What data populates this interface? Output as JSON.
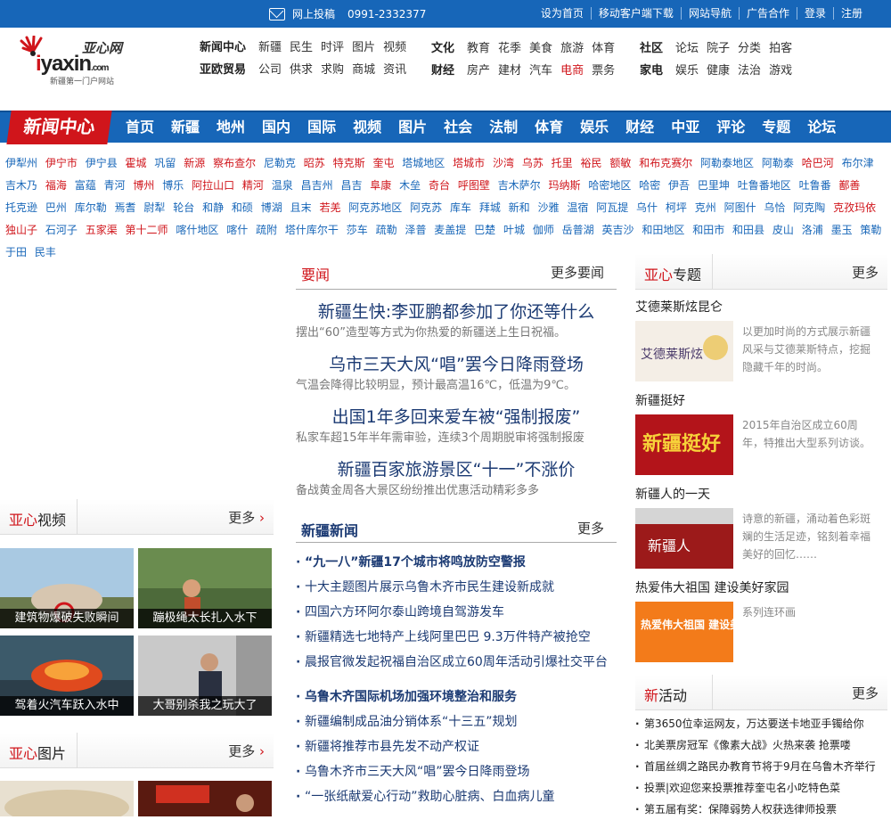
{
  "topbar": {
    "submit_label": "网上投稿",
    "phone": "0991-2332377",
    "links": [
      "设为首页",
      "移动客户端下载",
      "网站导航",
      "广告合作",
      "登录",
      "注册"
    ]
  },
  "logo": {
    "brand": "亚心网",
    "domain_pre": "i",
    "domain": "yaxin",
    "domain_suf": ".com",
    "slogan": "新疆第一门户网站"
  },
  "nav_groups": [
    {
      "rows": [
        {
          "head": "新闻中心",
          "items": [
            "新疆",
            "民生",
            "时评",
            "图片",
            "视频"
          ]
        },
        {
          "head": "亚欧贸易",
          "items": [
            "公司",
            "供求",
            "求购",
            "商城",
            "资讯"
          ]
        }
      ]
    },
    {
      "rows": [
        {
          "head": "文化",
          "items": [
            "教育",
            "花季",
            "美食",
            "旅游",
            "体育"
          ]
        },
        {
          "head": "财经",
          "items": [
            "房产",
            "建材",
            "汽车",
            "电商",
            "票务"
          ]
        }
      ]
    },
    {
      "rows": [
        {
          "head": "社区",
          "items": [
            "论坛",
            "院子",
            "分类",
            "拍客"
          ]
        },
        {
          "head": "家电",
          "items": [
            "娱乐",
            "健康",
            "法治",
            "游戏"
          ]
        }
      ]
    }
  ],
  "mainnav": {
    "title": "新闻中心",
    "items": [
      "首页",
      "新疆",
      "地州",
      "国内",
      "国际",
      "视频",
      "图片",
      "社会",
      "法制",
      "体育",
      "娱乐",
      "财经",
      "中亚",
      "评论",
      "专题",
      "论坛"
    ]
  },
  "regions": [
    {
      "t": "伊犁州"
    },
    {
      "t": "伊宁市",
      "red": true
    },
    {
      "t": "伊宁县"
    },
    {
      "t": "霍城",
      "red": true
    },
    {
      "t": "巩留"
    },
    {
      "t": "新源",
      "red": true
    },
    {
      "t": "察布查尔",
      "red": true
    },
    {
      "t": "尼勒克"
    },
    {
      "t": "昭苏",
      "red": true
    },
    {
      "t": "特克斯",
      "red": true
    },
    {
      "t": "奎屯",
      "red": true
    },
    {
      "t": "塔城地区"
    },
    {
      "t": "塔城市",
      "red": true
    },
    {
      "t": "沙湾",
      "red": true
    },
    {
      "t": "乌苏",
      "red": true
    },
    {
      "t": "托里",
      "red": true
    },
    {
      "t": "裕民",
      "red": true
    },
    {
      "t": "额敏",
      "red": true
    },
    {
      "t": "和布克赛尔",
      "red": true
    },
    {
      "t": "阿勒泰地区"
    },
    {
      "t": "阿勒泰"
    },
    {
      "t": "哈巴河",
      "red": true
    },
    {
      "t": "布尔津"
    },
    {
      "t": "吉木乃"
    },
    {
      "t": "福海",
      "red": true
    },
    {
      "t": "富蕴"
    },
    {
      "t": "青河"
    },
    {
      "t": "博州",
      "red": true
    },
    {
      "t": "博乐"
    },
    {
      "t": "阿拉山口",
      "red": true
    },
    {
      "t": "精河",
      "red": true
    },
    {
      "t": "温泉"
    },
    {
      "t": "昌吉州"
    },
    {
      "t": "昌吉"
    },
    {
      "t": "阜康",
      "red": true
    },
    {
      "t": "木垒"
    },
    {
      "t": "奇台",
      "red": true
    },
    {
      "t": "呼图壁",
      "red": true
    },
    {
      "t": "吉木萨尔"
    },
    {
      "t": "玛纳斯",
      "red": true
    },
    {
      "t": "哈密地区"
    },
    {
      "t": "哈密"
    },
    {
      "t": "伊吾"
    },
    {
      "t": "巴里坤"
    },
    {
      "t": "吐鲁番地区"
    },
    {
      "t": "吐鲁番"
    },
    {
      "t": "鄯善",
      "red": true
    },
    {
      "t": "托克逊"
    },
    {
      "t": "巴州"
    },
    {
      "t": "库尔勒"
    },
    {
      "t": "焉耆"
    },
    {
      "t": "尉犁"
    },
    {
      "t": "轮台"
    },
    {
      "t": "和静"
    },
    {
      "t": "和硕"
    },
    {
      "t": "博湖"
    },
    {
      "t": "且末"
    },
    {
      "t": "若羌",
      "red": true
    },
    {
      "t": "阿克苏地区"
    },
    {
      "t": "阿克苏"
    },
    {
      "t": "库车"
    },
    {
      "t": "拜城"
    },
    {
      "t": "新和"
    },
    {
      "t": "沙雅"
    },
    {
      "t": "温宿"
    },
    {
      "t": "阿瓦提"
    },
    {
      "t": "乌什"
    },
    {
      "t": "柯坪"
    },
    {
      "t": "克州"
    },
    {
      "t": "阿图什"
    },
    {
      "t": "乌恰"
    },
    {
      "t": "阿克陶"
    },
    {
      "t": "克孜玛依",
      "red": true
    },
    {
      "t": "独山子",
      "red": true
    },
    {
      "t": "石河子"
    },
    {
      "t": "五家渠",
      "red": true
    },
    {
      "t": "第十二师",
      "red": true
    },
    {
      "t": "喀什地区"
    },
    {
      "t": "喀什"
    },
    {
      "t": "疏附"
    },
    {
      "t": "塔什库尔干"
    },
    {
      "t": "莎车"
    },
    {
      "t": "疏勒"
    },
    {
      "t": "泽普"
    },
    {
      "t": "麦盖提"
    },
    {
      "t": "巴楚"
    },
    {
      "t": "叶城"
    },
    {
      "t": "伽师"
    },
    {
      "t": "岳普湖"
    },
    {
      "t": "英吉沙"
    },
    {
      "t": "和田地区"
    },
    {
      "t": "和田市"
    },
    {
      "t": "和田县"
    },
    {
      "t": "皮山"
    },
    {
      "t": "洛浦"
    },
    {
      "t": "墨玉"
    },
    {
      "t": "策勒"
    },
    {
      "t": "于田"
    },
    {
      "t": "民丰"
    }
  ],
  "yaowen": {
    "title": "要闻",
    "more": "更多要闻",
    "stories": [
      {
        "h": "新疆生快:李亚鹏都参加了你还等什么",
        "d": "摆出“60”造型等方式为你热爱的新疆送上生日祝福。"
      },
      {
        "h": "乌市三天大风“唱”罢今日降雨登场",
        "d": "气温会降得比较明显，预计最高温16℃，低温为9℃。"
      },
      {
        "h": "出国1年多回来爱车被“强制报废”",
        "d": "私家车超15年半年需审验，连续3个周期脱审将强制报废"
      },
      {
        "h": "新疆百家旅游景区“十一”不涨价",
        "d": "备战黄金周各大景区纷纷推出优惠活动精彩多多"
      }
    ]
  },
  "xjnews": {
    "title": "新疆新闻",
    "more": "更多",
    "items": [
      {
        "t": "“九一八”新疆17个城市将鸣放防空警报",
        "bold": true
      },
      {
        "t": "十大主题图片展示乌鲁木齐市民生建设新成就"
      },
      {
        "t": "四国六方环阿尔泰山跨境自驾游发车"
      },
      {
        "t": "新疆精选七地特产上线阿里巴巴 9.3万件特产被抢空"
      },
      {
        "t": "晨报官微发起祝福自治区成立60周年活动引爆社交平台"
      },
      {
        "t": "乌鲁木齐国际机场加强环境整治和服务",
        "bold": true
      },
      {
        "t": "新疆编制成品油分销体系“十三五”规划"
      },
      {
        "t": "新疆将推荐市县先发不动产权证"
      },
      {
        "t": "乌鲁木齐市三天大风“唱”罢今日降雨登场"
      },
      {
        "t": "“一张纸献爱心行动”救助心脏病、白血病儿童"
      }
    ]
  },
  "video": {
    "title_red": "亚心",
    "title": "视频",
    "more": "更多",
    "items": [
      "建筑物爆破失败瞬间",
      "蹦极绳太长扎入水下",
      "驾着火汽车跃入水中",
      "大哥别杀我之玩大了"
    ]
  },
  "pics": {
    "title_red": "亚心",
    "title": "图片",
    "more": "更多"
  },
  "topics": {
    "title_red": "亚心",
    "title": "专题",
    "more": "更多",
    "items": [
      {
        "t": "艾德莱斯炫昆仑",
        "d": "以更加时尚的方式展示新疆风采与艾德莱斯特点，挖掘隐藏千年的时尚。",
        "img": "艾德莱斯炫"
      },
      {
        "t": "新疆挺好",
        "d": "2015年自治区成立60周年，特推出大型系列访谈。",
        "img": "新疆挺好"
      },
      {
        "t": "新疆人的一天",
        "d": "诗意的新疆，涌动着色彩斑斓的生活足迹，铭刻着幸福美好的回忆……",
        "img": "新疆人"
      },
      {
        "t": "热爱伟大祖国 建设美好家园",
        "d": "系列连环画",
        "img": "热爱伟大祖国 建设美好家园"
      }
    ]
  },
  "activity": {
    "title_red": "新",
    "title": "活动",
    "more": "更多",
    "items": [
      "第3650位幸运网友，万达要送卡地亚手镯给你",
      "北美票房冠军《像素大战》火热来袭 抢票喽",
      "首届丝绸之路民办教育节将于9月在乌鲁木齐举行",
      "投票|欢迎您来投票推荐奎屯名小吃特色菜",
      "第五届有奖：保障弱势人权获选律师投票"
    ]
  },
  "colors": {
    "brand_blue": "#1766b8",
    "brand_red": "#d0151b",
    "headline_navy": "#1b3a73"
  }
}
